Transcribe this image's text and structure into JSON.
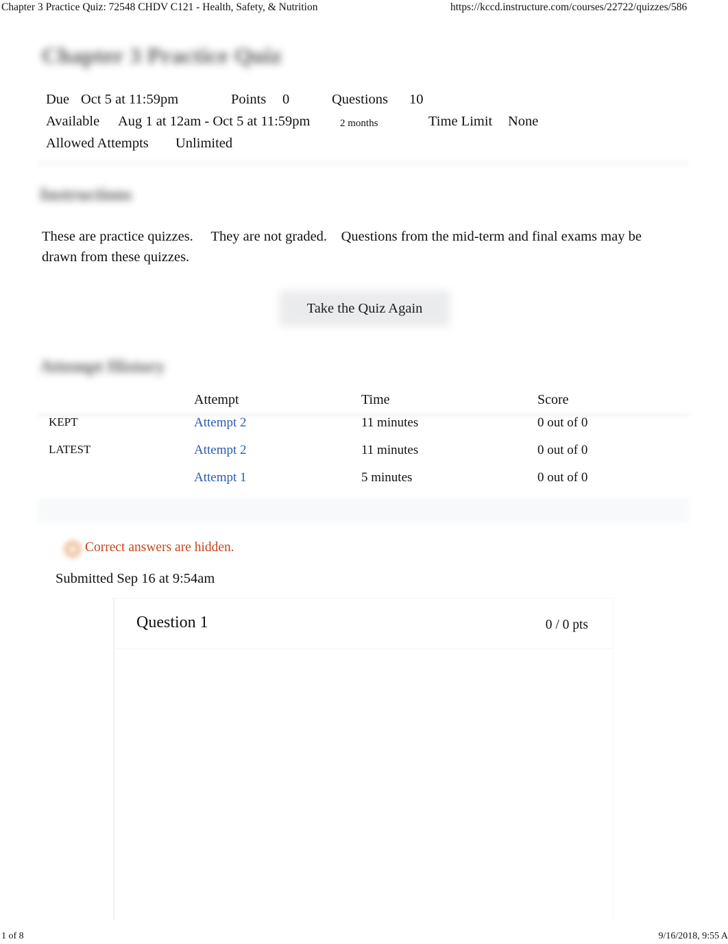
{
  "print_header": {
    "document_title": "Chapter 3 Practice Quiz: 72548 CHDV C121 - Health, Safety, & Nutrition",
    "url": "https://kccd.instructure.com/courses/22722/quizzes/586"
  },
  "print_footer": {
    "page_indicator": "1 of 8",
    "timestamp": "9/16/2018, 9:55 A"
  },
  "quiz": {
    "title": "Chapter 3 Practice Quiz",
    "meta": {
      "due_label": "Due",
      "due_value": "Oct 5 at 11:59pm",
      "points_label": "Points",
      "points_value": "0",
      "questions_label": "Questions",
      "questions_value": "10",
      "available_label": "Available",
      "available_value": "Aug 1 at 12am - Oct 5 at 11:59pm",
      "available_duration": "2 months",
      "time_limit_label": "Time Limit",
      "time_limit_value": "None",
      "allowed_attempts_label": "Allowed Attempts",
      "allowed_attempts_value": "Unlimited"
    }
  },
  "instructions": {
    "heading": "Instructions",
    "sentence_1": "These are practice quizzes.",
    "sentence_2": "They are not graded.",
    "sentence_3": "Questions from the mid-term and final exams may be",
    "sentence_4": "drawn from these quizzes."
  },
  "actions": {
    "take_quiz_again": "Take the Quiz Again"
  },
  "attempt_history": {
    "heading": "Attempt History",
    "columns": {
      "status": "",
      "attempt": "Attempt",
      "time": "Time",
      "score": "Score"
    },
    "rows": [
      {
        "status": "KEPT",
        "attempt": "Attempt 2",
        "time": "11 minutes",
        "score": "0 out of 0"
      },
      {
        "status": "LATEST",
        "attempt": "Attempt 2",
        "time": "11 minutes",
        "score": "0 out of 0"
      },
      {
        "status": "",
        "attempt": "Attempt 1",
        "time": "5 minutes",
        "score": "0 out of 0"
      }
    ]
  },
  "notice": {
    "icon": "lock-icon",
    "text": "Correct answers are hidden.",
    "color": "#c4471a"
  },
  "submission": {
    "submitted_text": "Submitted Sep 16 at 9:54am"
  },
  "question": {
    "label": "Question 1",
    "points": "0 / 0 pts"
  },
  "colors": {
    "link": "#2a5bb0",
    "notice": "#c4471a",
    "text": "#111111",
    "divider": "#f6f8fa"
  }
}
